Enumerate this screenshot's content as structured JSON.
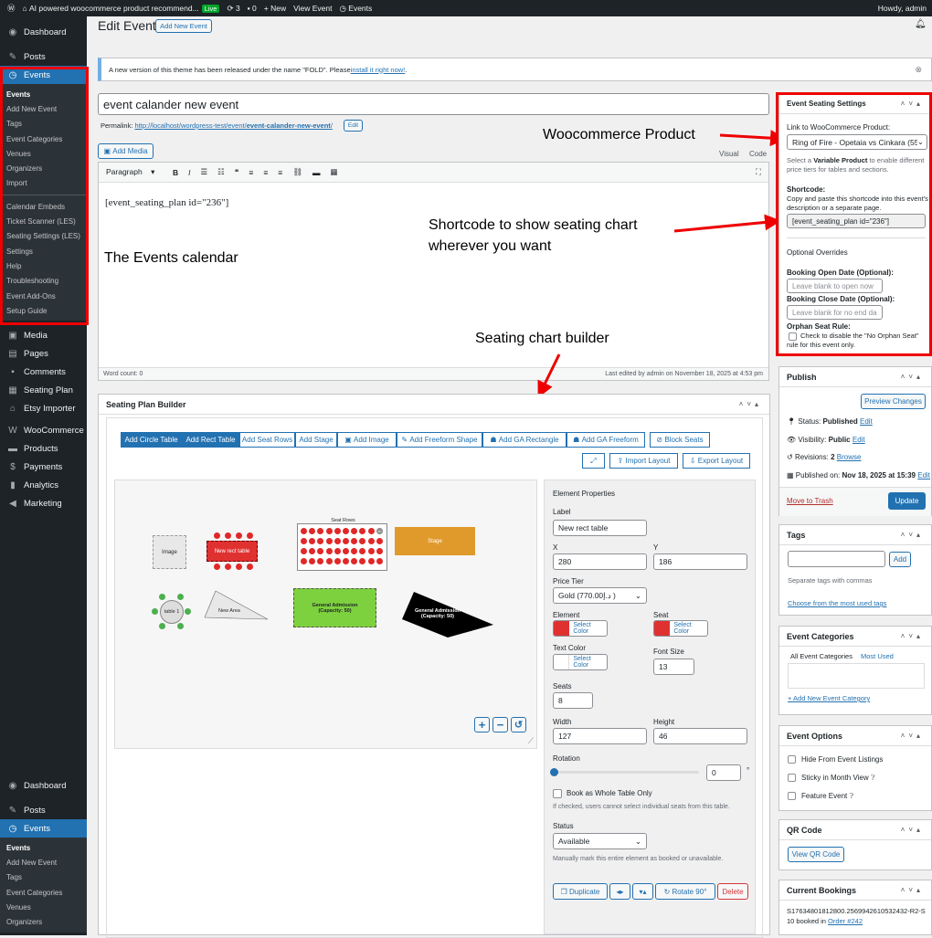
{
  "adminbar": {
    "site": "AI powered woocommerce product recommend...",
    "live": "Live",
    "updates": "3",
    "comments": "0",
    "new": "New",
    "view": "View Event",
    "events": "Events",
    "howdy": "Howdy, admin"
  },
  "menu": {
    "dashboard": "Dashboard",
    "posts": "Posts",
    "events": "Events",
    "events_sub": [
      "Events",
      "Add New Event",
      "Tags",
      "Event Categories",
      "Venues",
      "Organizers",
      "Import"
    ],
    "events_sub2": [
      "Calendar Embeds",
      "Ticket Scanner (LES)",
      "Seating Settings (LES)",
      "Settings",
      "Help",
      "Troubleshooting",
      "Event Add-Ons",
      "Setup Guide"
    ],
    "media": "Media",
    "pages": "Pages",
    "comments": "Comments",
    "seating": "Seating Plan",
    "etsy": "Etsy Importer",
    "woo": "WooCommerce",
    "products": "Products",
    "payments": "Payments",
    "analytics": "Analytics",
    "marketing": "Marketing",
    "sub_bottom": [
      "Events",
      "Add New Event",
      "Tags",
      "Event Categories",
      "Venues",
      "Organizers"
    ]
  },
  "page": {
    "title": "Edit Event",
    "add_new": "Add New Event",
    "notice_pre": "A new version of this theme has been released under the name \"FOLD\". Please ",
    "notice_link": "install it right now!",
    "notice_post": ".",
    "post_title": "event calander new event",
    "permalink_label": "Permalink:",
    "permalink_url": "http://localhost/wordpress-test/event/",
    "permalink_slug": "event-calander-new-event",
    "permalink_tail": "/",
    "edit": "Edit",
    "add_media": "Add Media",
    "visual": "Visual",
    "code": "Code",
    "paragraph": "Paragraph",
    "content": "[event_seating_plan id=\"236\"]",
    "word_count": "Word count: 0",
    "last_edited": "Last edited by admin on November 18, 2025 at 4:53 pm"
  },
  "annotations": {
    "woo": "Woocommerce Product",
    "shortcode1": "Shortcode to show seating chart",
    "shortcode2": "wherever you want",
    "calendar": "The Events calendar",
    "builder": "Seating chart builder"
  },
  "builder": {
    "title": "Seating Plan Builder",
    "tools": [
      "Add Circle Table",
      "Add Rect Table",
      "Add Seat Rows",
      "Add Stage",
      "Add Image",
      "Add Freeform Shape",
      "Add GA Rectangle",
      "Add GA Freeform",
      "Block Seats"
    ],
    "import": "Import Layout",
    "export": "Export Layout",
    "canvas": {
      "image": "Image",
      "rect_table": "New rect table",
      "seat_rows": "Seat Rows",
      "seat_num": "10",
      "stage": "Stage",
      "circle": "table 1",
      "area": "New Area",
      "ga1": "General Admission",
      "ga1cap": "(Capacity: 50)",
      "ga2": "General Admission",
      "ga2cap": "(Capacity: 50)"
    },
    "props": {
      "heading": "Element Properties",
      "label": "Label",
      "label_val": "New rect table",
      "x": "X",
      "x_val": "280",
      "y": "Y",
      "y_val": "186",
      "price_tier": "Price Tier",
      "price_val": "Gold (770.00ﺩ.ﺇ )",
      "element": "Element",
      "seat": "Seat",
      "select_color": "Select Color",
      "text_color": "Text Color",
      "font_size": "Font Size",
      "font_val": "13",
      "seats": "Seats",
      "seats_val": "8",
      "width": "Width",
      "width_val": "127",
      "height": "Height",
      "height_val": "46",
      "rotation": "Rotation",
      "rot_val": "0",
      "deg": "°",
      "whole": "Book as Whole Table Only",
      "whole_help": "If checked, users cannot select individual seats from this table.",
      "status": "Status",
      "status_val": "Available",
      "status_help": "Manually mark this entire element as booked or unavailable.",
      "duplicate": "Duplicate",
      "rotate90": "Rotate 90°",
      "delete": "Delete"
    },
    "colors": {
      "element": "#e03131",
      "seat": "#e03131",
      "text": "#ffffff"
    }
  },
  "seating": {
    "title": "Event Seating Settings",
    "link_label": "Link to WooCommerce Product:",
    "product": "Ring of Fire - Opetaia vs Cinkara (55",
    "help_pre": "Select a ",
    "help_bold": "Variable Product",
    "help_post": " to enable different price tiers for tables and sections.",
    "shortcode": "Shortcode:",
    "sc_help": "Copy and paste this shortcode into this event's description or a separate page.",
    "sc_val": "[event_seating_plan id=\"236\"]",
    "optional": "Optional Overrides",
    "open": "Booking Open Date (Optional):",
    "open_ph": "Leave blank to open now",
    "close": "Booking Close Date (Optional):",
    "close_ph": "Leave blank for no end da",
    "orphan": "Orphan Seat Rule:",
    "orphan_cb": "Check to disable the \"No Orphan Seat\" rule for this event only."
  },
  "publish": {
    "title": "Publish",
    "preview": "Preview Changes",
    "status": "Status:",
    "status_v": "Published",
    "visibility": "Visibility:",
    "visibility_v": "Public",
    "revisions": "Revisions:",
    "revisions_v": "2",
    "browse": "Browse",
    "published": "Published on:",
    "published_v": "Nov 18, 2025 at 15:39",
    "trash": "Move to Trash",
    "update": "Update",
    "edit": "Edit"
  },
  "tags": {
    "title": "Tags",
    "add": "Add",
    "help": "Separate tags with commas",
    "choose": "Choose from the most used tags"
  },
  "cats": {
    "title": "Event Categories",
    "all": "All Event Categories",
    "most": "Most Used",
    "add": "+ Add New Event Category"
  },
  "options": {
    "title": "Event Options",
    "hide": "Hide From Event Listings",
    "sticky": "Sticky in Month View",
    "feature": "Feature Event"
  },
  "qr": {
    "title": "QR Code",
    "view": "View QR Code"
  },
  "bookings": {
    "title": "Current Bookings",
    "text": "S17634801812800.2569942610532432-R2-S10 booked in ",
    "order": "Order #242"
  }
}
